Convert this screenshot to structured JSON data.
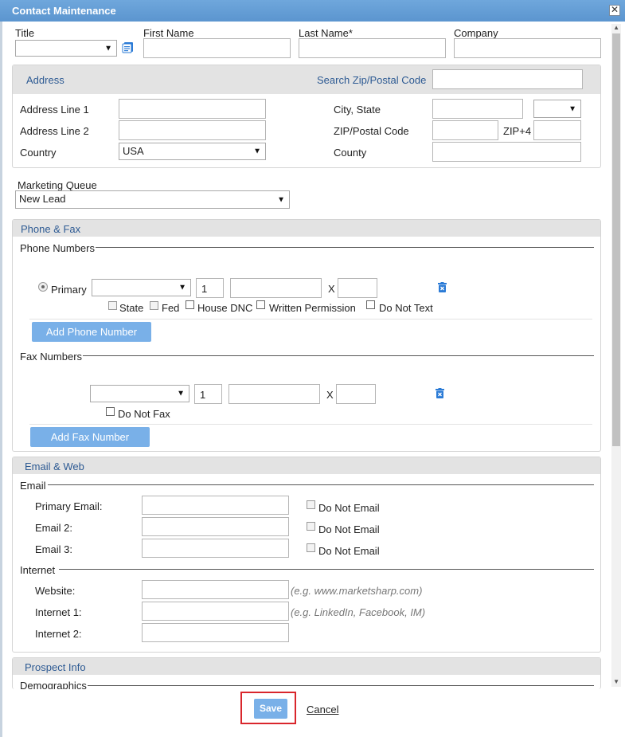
{
  "window": {
    "title": "Contact Maintenance",
    "close_glyph": "✕"
  },
  "top": {
    "title_label": "Title",
    "first_name_label": "First Name",
    "last_name_label": "Last Name*",
    "company_label": "Company"
  },
  "address": {
    "header": "Address",
    "search_label": "Search Zip/Postal Code",
    "line1_label": "Address Line 1",
    "line2_label": "Address Line 2",
    "country_label": "Country",
    "country_value": "USA",
    "city_state_label": "City, State",
    "zip_label": "ZIP/Postal Code",
    "zip4_label": "ZIP+4",
    "county_label": "County"
  },
  "marketing": {
    "label": "Marketing Queue",
    "value": "New Lead"
  },
  "phone_fax": {
    "header": "Phone & Fax",
    "phone_group": "Phone Numbers",
    "primary_label": "Primary",
    "country_code": "1",
    "ext_label": "X",
    "flags": [
      "State",
      "Fed",
      "House DNC",
      "Written Permission",
      "Do Not Text"
    ],
    "add_phone": "Add Phone Number",
    "fax_group": "Fax Numbers",
    "fax_country_code": "1",
    "fax_ext_label": "X",
    "do_not_fax": "Do Not Fax",
    "add_fax": "Add Fax Number"
  },
  "email_web": {
    "header": "Email & Web",
    "email_group": "Email",
    "primary_email": "Primary Email:",
    "email2": "Email 2:",
    "email3": "Email 3:",
    "do_not_email": "Do Not Email",
    "internet_group": "Internet",
    "website": "Website:",
    "website_hint": "(e.g. www.marketsharp.com)",
    "internet1": "Internet 1:",
    "internet1_hint": "(e.g. LinkedIn, Facebook, IM)",
    "internet2": "Internet 2:"
  },
  "prospect": {
    "header": "Prospect Info",
    "demographics": "Demographics"
  },
  "footer": {
    "save": "Save",
    "cancel": "Cancel"
  },
  "colors": {
    "accent": "#5b95cf",
    "button": "#79b0e8",
    "highlight": "#d9262c",
    "section_text": "#2d5a93"
  }
}
